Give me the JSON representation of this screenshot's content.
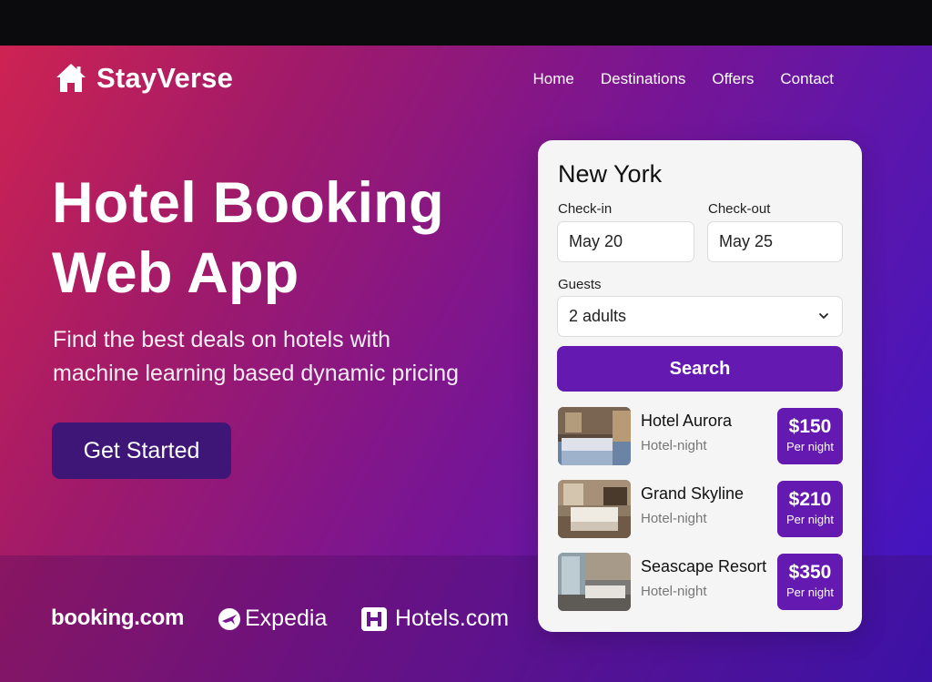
{
  "brand": {
    "name": "StayVerse",
    "icon": "house-icon"
  },
  "nav": [
    "Home",
    "Destinations",
    "Offers",
    "Contact"
  ],
  "hero": {
    "title_line1": "Hotel Booking",
    "title_line2": "Web App",
    "subtitle_line1": "Find the best deals on hotels with",
    "subtitle_line2": "machine learning based dynamic pricing",
    "cta": "Get Started"
  },
  "partners": [
    "booking.com",
    "Expedia",
    "Hotels.com"
  ],
  "search": {
    "city": "New York",
    "checkin_label": "Check-in",
    "checkin_value": "May 20",
    "checkout_label": "Check-out",
    "checkout_value": "May 25",
    "guests_label": "Guests",
    "guests_value": "2 adults",
    "search_button": "Search"
  },
  "hotels": [
    {
      "name": "Hotel Aurora",
      "type": "Hotel-night",
      "price": "$150",
      "unit": "Per night"
    },
    {
      "name": "Grand Skyline",
      "type": "Hotel-night",
      "price": "$210",
      "unit": "Per night"
    },
    {
      "name": "Seascape Resort",
      "type": "Hotel-night",
      "price": "$350",
      "unit": "Per night"
    }
  ],
  "colors": {
    "accent": "#6419b0",
    "cta_bg": "#3e1677",
    "gradient_start": "#cd2352",
    "gradient_end": "#3d14c4"
  }
}
